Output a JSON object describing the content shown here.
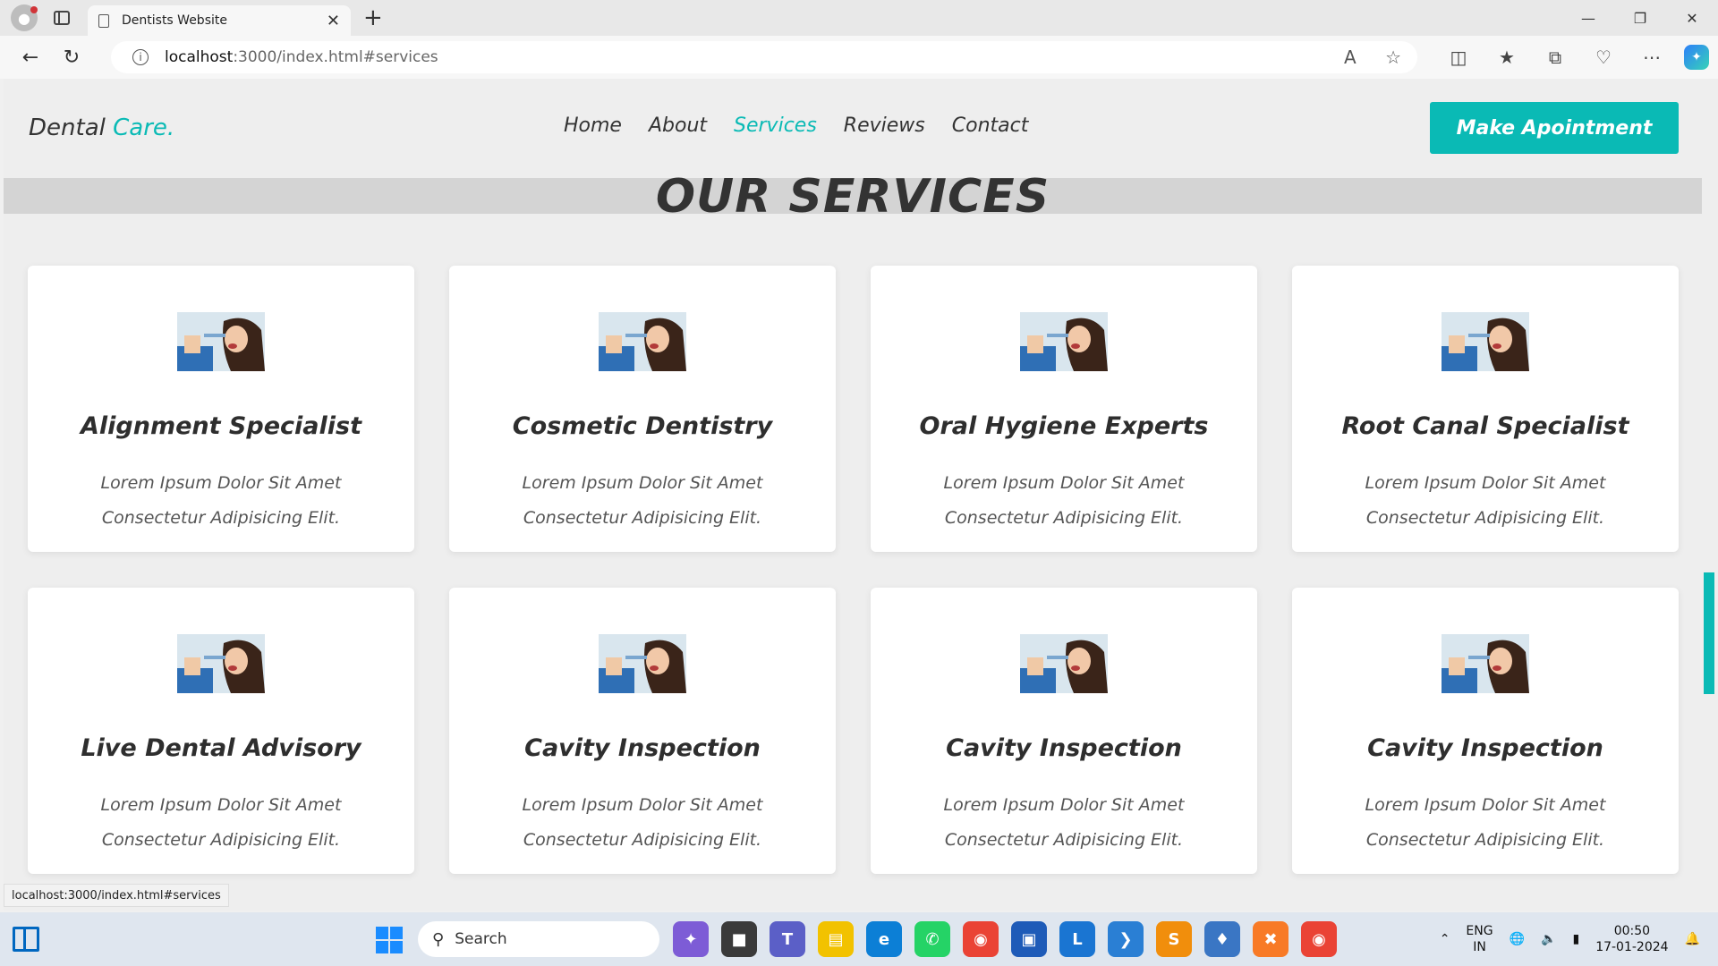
{
  "browser": {
    "tab_title": "Dentists Website",
    "url_host": "localhost",
    "url_path": ":3000/index.html#services",
    "status_url": "localhost:3000/index.html#services"
  },
  "site": {
    "logo_main": "Dental",
    "logo_accent": "Care.",
    "nav": [
      "Home",
      "About",
      "Services",
      "Reviews",
      "Contact"
    ],
    "active_nav": "Services",
    "cta_label": "Make Apointment",
    "section_title": "OUR SERVICES",
    "accent_color": "#0abab5"
  },
  "services": [
    {
      "title": "Alignment Specialist",
      "line1": "Lorem Ipsum Dolor Sit Amet",
      "line2": "Consectetur Adipisicing Elit."
    },
    {
      "title": "Cosmetic Dentistry",
      "line1": "Lorem Ipsum Dolor Sit Amet",
      "line2": "Consectetur Adipisicing Elit."
    },
    {
      "title": "Oral Hygiene Experts",
      "line1": "Lorem Ipsum Dolor Sit Amet",
      "line2": "Consectetur Adipisicing Elit."
    },
    {
      "title": "Root Canal Specialist",
      "line1": "Lorem Ipsum Dolor Sit Amet",
      "line2": "Consectetur Adipisicing Elit."
    },
    {
      "title": "Live Dental Advisory",
      "line1": "Lorem Ipsum Dolor Sit Amet",
      "line2": "Consectetur Adipisicing Elit."
    },
    {
      "title": "Cavity Inspection",
      "line1": "Lorem Ipsum Dolor Sit Amet",
      "line2": "Consectetur Adipisicing Elit."
    },
    {
      "title": "Cavity Inspection",
      "line1": "Lorem Ipsum Dolor Sit Amet",
      "line2": "Consectetur Adipisicing Elit."
    },
    {
      "title": "Cavity Inspection",
      "line1": "Lorem Ipsum Dolor Sit Amet",
      "line2": "Consectetur Adipisicing Elit."
    }
  ],
  "taskbar": {
    "search_placeholder": "Search",
    "lang_line1": "ENG",
    "lang_line2": "IN",
    "time": "00:50",
    "date": "17-01-2024"
  }
}
